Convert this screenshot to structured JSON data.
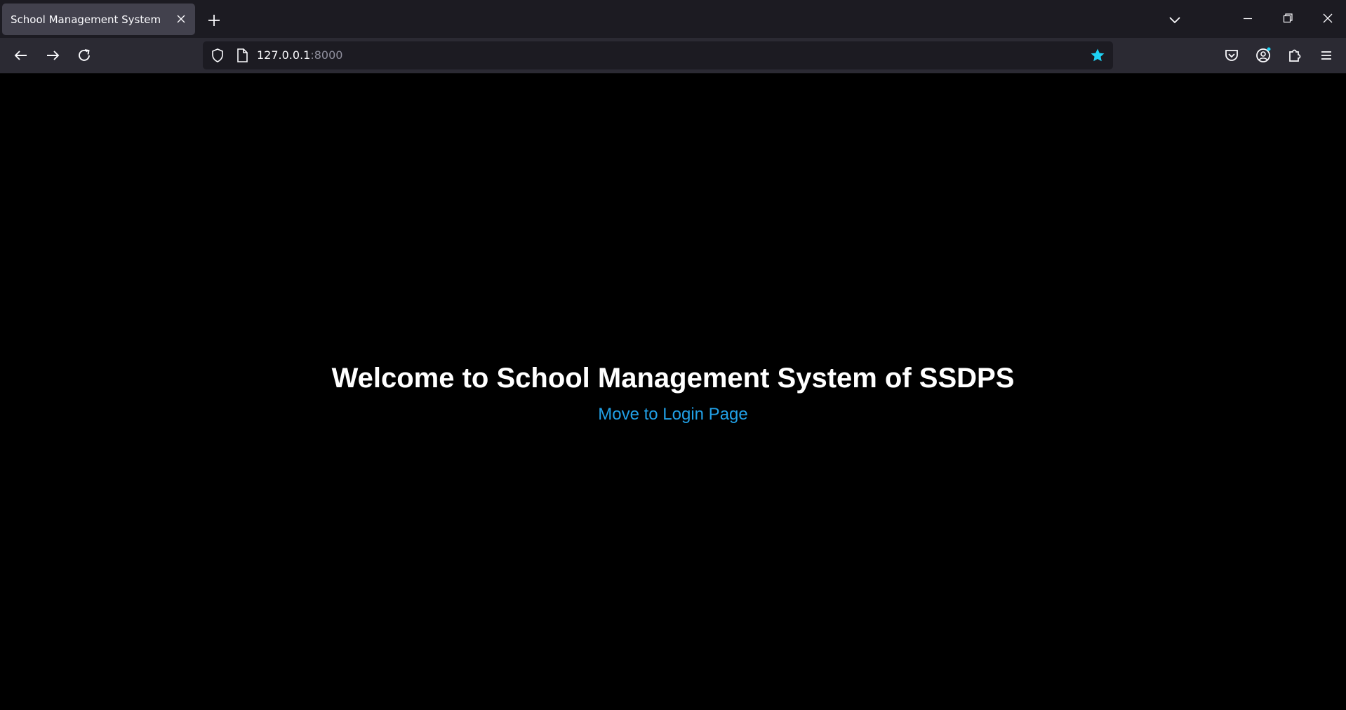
{
  "browser": {
    "tab": {
      "title": "School Management System"
    },
    "url": {
      "host": "127.0.0.1",
      "port": ":8000"
    },
    "accent_color": "#1ed2f4"
  },
  "icons": {
    "tab_close": "close-icon",
    "new_tab": "plus-icon",
    "tab_list": "chevron-down-icon",
    "minimize": "minimize-icon",
    "restore": "restore-icon",
    "close_window": "close-icon",
    "back": "arrow-left-icon",
    "forward": "arrow-right-icon",
    "reload": "reload-icon",
    "tracking": "shield-icon",
    "page": "page-icon",
    "bookmark": "star-icon",
    "pocket": "pocket-icon",
    "account": "account-icon",
    "extensions": "puzzle-icon",
    "menu": "hamburger-menu-icon"
  },
  "page": {
    "heading": "Welcome to School Management System of SSDPS",
    "link_text": "Move to Login Page",
    "link_color": "#21a0e6",
    "background": "#000000"
  }
}
